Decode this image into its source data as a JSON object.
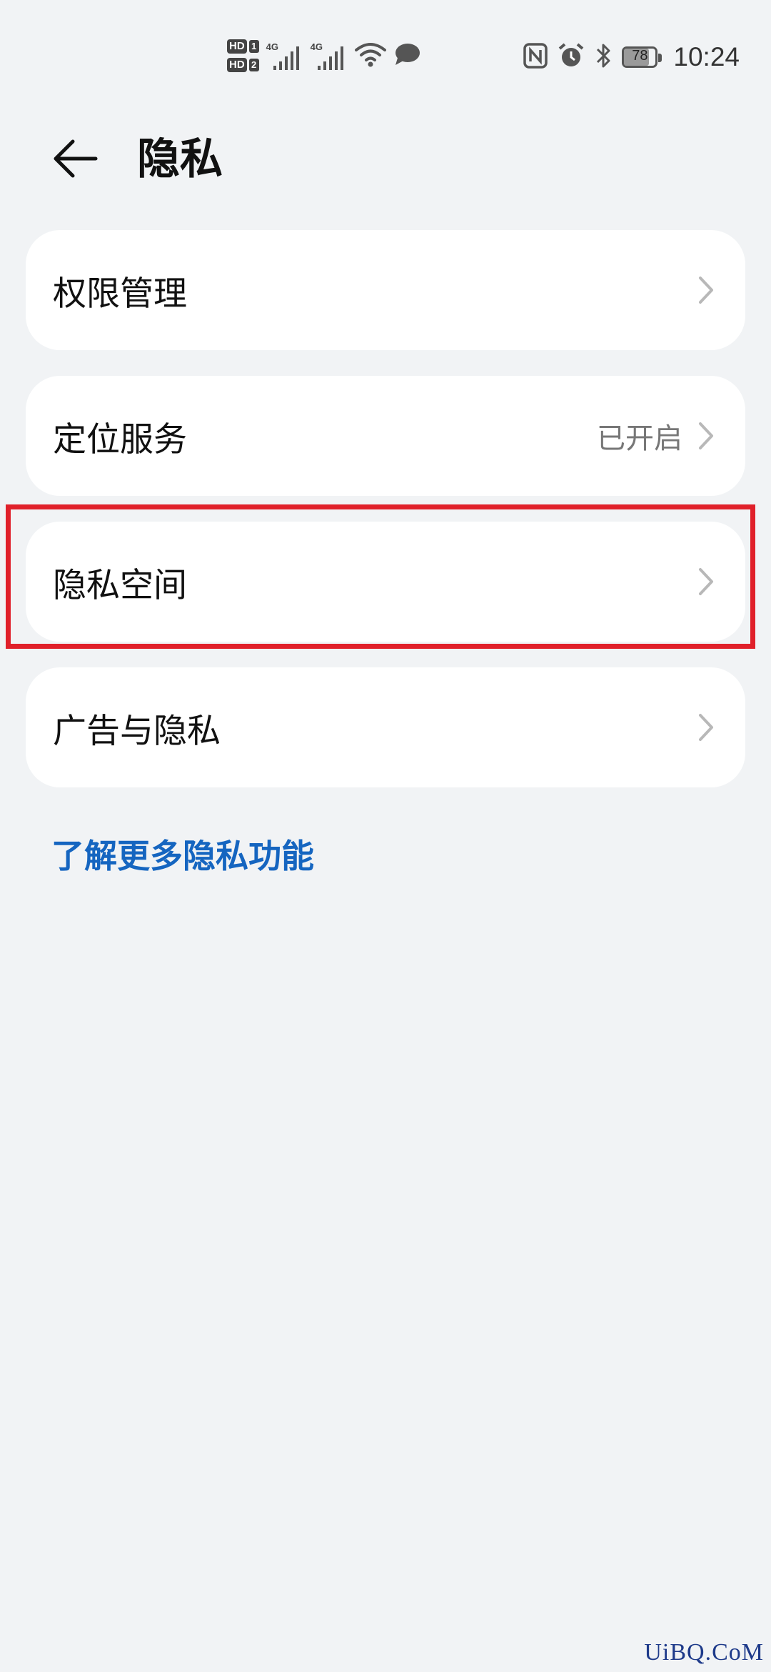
{
  "status_bar": {
    "hd1": "HD",
    "hd1_index": "1",
    "hd2": "HD",
    "hd2_index": "2",
    "net1": "4G",
    "net2": "4G",
    "battery_level": "78",
    "time": "10:24",
    "icons": [
      "signal-icon",
      "wifi-icon",
      "message-icon",
      "nfc-icon",
      "alarm-icon",
      "bluetooth-icon",
      "battery-icon"
    ]
  },
  "header": {
    "title": "隐私",
    "back_icon": "back-arrow-icon"
  },
  "menu": {
    "items": [
      {
        "label": "权限管理",
        "value": ""
      },
      {
        "label": "定位服务",
        "value": "已开启"
      },
      {
        "label": "隐私空间",
        "value": ""
      },
      {
        "label": "广告与隐私",
        "value": ""
      }
    ]
  },
  "link": {
    "more": "了解更多隐私功能"
  },
  "watermark": "UiBQ.CoM",
  "colors": {
    "background": "#f1f3f5",
    "card": "#ffffff",
    "link": "#1565c0",
    "highlight": "#e0202a"
  }
}
